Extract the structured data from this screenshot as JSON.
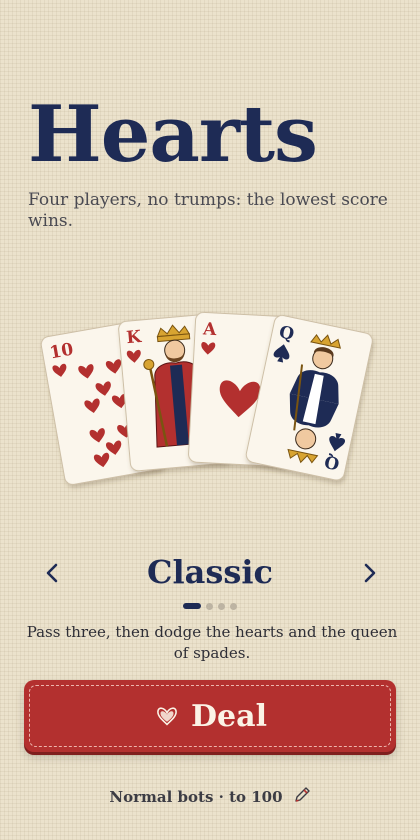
{
  "app": {
    "title": "Hearts",
    "subtitle": "Four players, no trumps: the lowest score wins."
  },
  "cards": [
    {
      "rank": "10",
      "suit": "hearts",
      "icon": "ten-of-hearts"
    },
    {
      "rank": "K",
      "suit": "hearts",
      "icon": "king-of-hearts"
    },
    {
      "rank": "A",
      "suit": "hearts",
      "icon": "ace-of-hearts"
    },
    {
      "rank": "Q",
      "suit": "spades",
      "icon": "queen-of-spades"
    }
  ],
  "mode": {
    "name": "Classic",
    "description": "Pass three, then dodge the hearts and the queen of spades.",
    "page_count": 4,
    "current_page": 1,
    "prev_icon": "chevron-left-icon",
    "next_icon": "chevron-right-icon"
  },
  "deal": {
    "label": "Deal",
    "icon": "heart-icon"
  },
  "settings": {
    "label": "Normal bots · to 100",
    "icon": "pencil-icon"
  },
  "colors": {
    "background": "#ebe2cc",
    "navy": "#1e2b55",
    "red": "#b3302f",
    "card": "#fbf6ec"
  }
}
